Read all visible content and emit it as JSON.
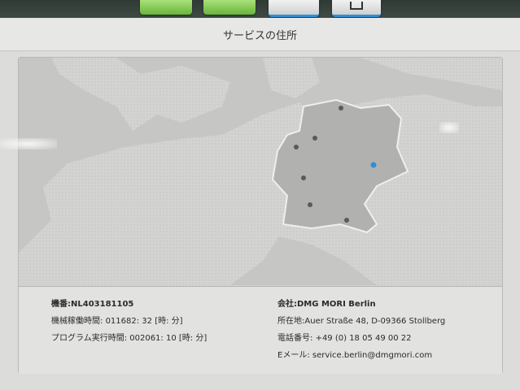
{
  "header": {
    "title": "サービスの住所"
  },
  "machine": {
    "number_label": "機番:",
    "number_value": "NL403181105",
    "runtime_label": "機械稼働時間: ",
    "runtime_value": "011682: 32 [時: 分]",
    "program_label": "プログラム実行時間: ",
    "program_value": "002061: 10 [時: 分]"
  },
  "company": {
    "company_label": "会社:",
    "company_value": "DMG MORI Berlin",
    "address_label": "所在地:",
    "address_value": "Auer Straße 48, D-09366 Stollberg",
    "phone_label": "電話番号: ",
    "phone_value": "+49 (0) 18 05 49 00 22",
    "email_label": "Eメール: ",
    "email_value": "service.berlin@dmgmori.com"
  },
  "map": {
    "marker_color": "#5a5a5a",
    "selected_marker_color": "#2f8fd8",
    "highlighted_country_color": "#b2b2b0"
  }
}
